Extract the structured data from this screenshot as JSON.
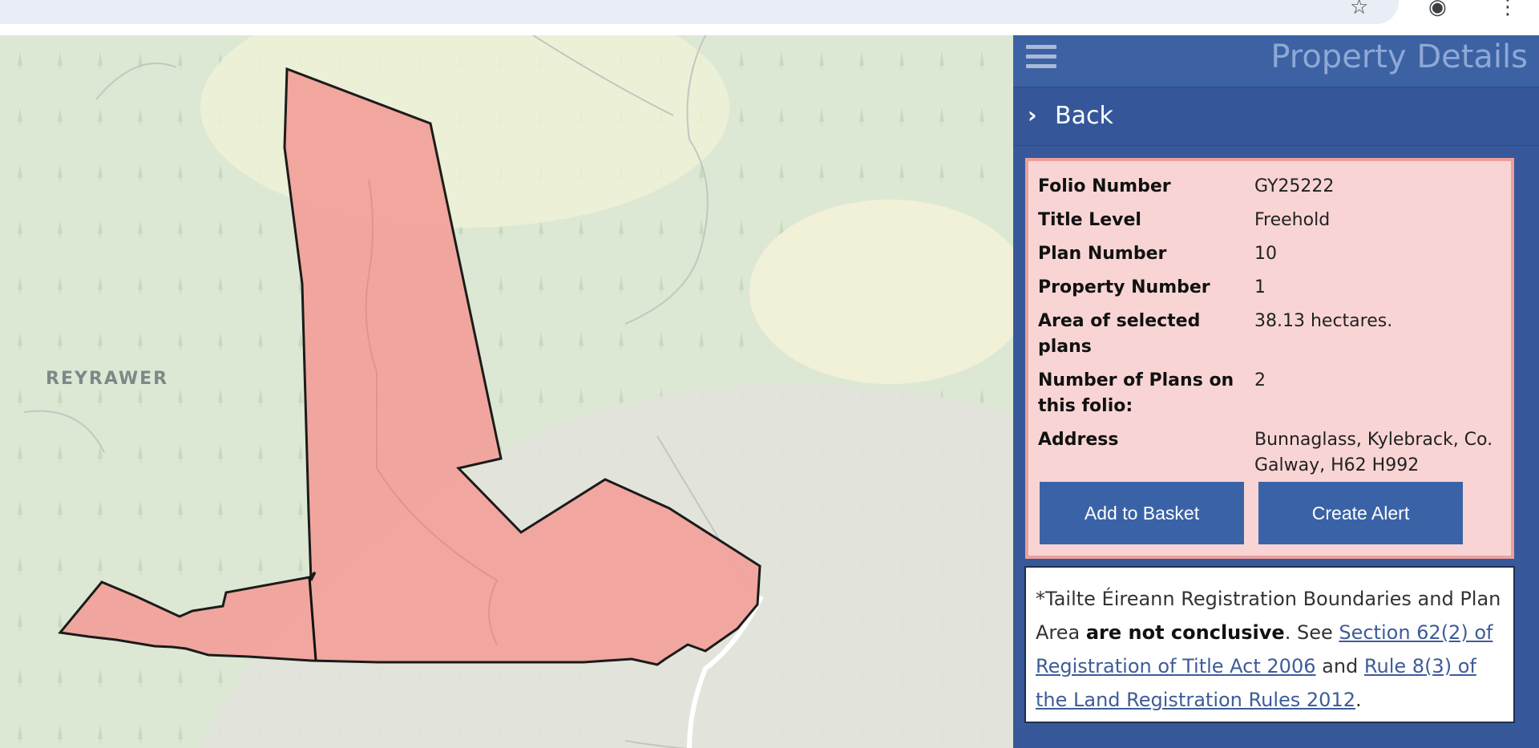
{
  "browser": {
    "star_icon": "star-outline-icon",
    "profile_icon": "profile-icon",
    "menu_icon": "kebab-menu-icon"
  },
  "map": {
    "place_label": "REYRAWER",
    "parcel_fill": "#f2a39c",
    "parcel_stroke": "#111111"
  },
  "panel": {
    "menu_icon": "hamburger-icon",
    "title": "Property Details",
    "back_label": "Back",
    "details": [
      {
        "key": "Folio Number",
        "value": "GY25222"
      },
      {
        "key": "Title Level",
        "value": "Freehold"
      },
      {
        "key": "Plan Number",
        "value": "10"
      },
      {
        "key": "Property Number",
        "value": "1"
      },
      {
        "key": "Area of selected plans",
        "value": "38.13 hectares."
      },
      {
        "key": "Number of Plans on this folio:",
        "value": "2"
      },
      {
        "key": "Address",
        "value": "Bunnaglass, Kylebrack, Co. Galway, H62 H992"
      }
    ],
    "buttons": {
      "add_to_basket": "Add to Basket",
      "create_alert": "Create Alert"
    },
    "disclaimer": {
      "prefix": "*Tailte Éireann Registration Boundaries and Plan Area ",
      "bold": "are not conclusive",
      "mid": ". See ",
      "link1": "Section 62(2) of Registration of Title Act 2006",
      "and": " and ",
      "link2": "Rule 8(3) of the Land Registration Rules 2012",
      "end": "."
    },
    "colors": {
      "panel_bg": "#37599a",
      "header_bg": "#3d62a3",
      "card_bg": "#f8d5d4",
      "card_border": "#ee9f9b",
      "button_bg": "#3a63a7"
    }
  }
}
